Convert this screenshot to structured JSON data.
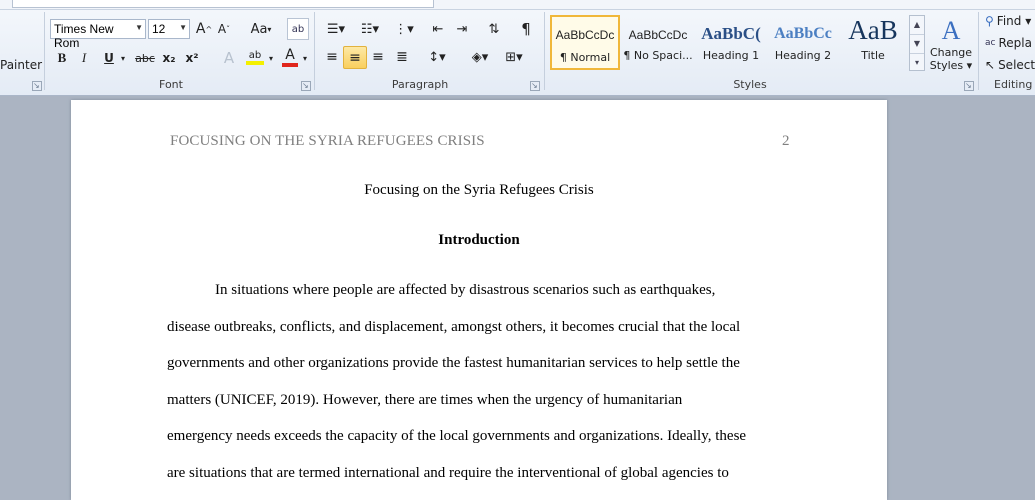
{
  "clipboard": {
    "painter_label": "Painter"
  },
  "font": {
    "name": "Times New Rom",
    "size": "12",
    "group_label": "Font",
    "grow": "A",
    "shrink": "A",
    "case": "Aa",
    "bold": "B",
    "italic": "I",
    "underline": "U",
    "strike": "abc",
    "sub": "x₂",
    "sup": "x²",
    "highlight": "ab",
    "color": "A"
  },
  "paragraph": {
    "group_label": "Paragraph",
    "pilcrow": "¶"
  },
  "styles": {
    "group_label": "Styles",
    "items": [
      {
        "sample": "AaBbCcDc",
        "name": "¶ Normal"
      },
      {
        "sample": "AaBbCcDc",
        "name": "¶ No Spaci..."
      },
      {
        "sample": "AaBbC(",
        "name": "Heading 1"
      },
      {
        "sample": "AaBbCc",
        "name": "Heading 2"
      },
      {
        "sample": "AaB",
        "name": "Title"
      }
    ],
    "change_line1": "Change",
    "change_line2": "Styles ▾"
  },
  "editing": {
    "group_label": "Editing",
    "find": "Find ▾",
    "replace": "Repla",
    "select": "Select"
  },
  "document": {
    "running_head": "FOCUSING ON THE SYRIA REFUGEES CRISIS",
    "page_number": "2",
    "title": "Focusing on the Syria Refugees Crisis",
    "heading": "Introduction",
    "lines": [
      "In situations where people are affected by disastrous scenarios such as earthquakes,",
      "disease outbreaks, conflicts, and displacement, amongst others, it becomes crucial that the local",
      "governments and other organizations provide the fastest humanitarian services to help settle the",
      "matters (UNICEF, 2019). However, there are times when the urgency of humanitarian",
      "emergency needs exceeds the capacity of the local governments and organizations. Ideally, these",
      "are situations that are termed international and require the interventional of global agencies to"
    ]
  },
  "colors": {
    "accent": "#f9cf5e",
    "font_color_red": "#e0261c",
    "highlight_yellow": "#f4f000"
  }
}
